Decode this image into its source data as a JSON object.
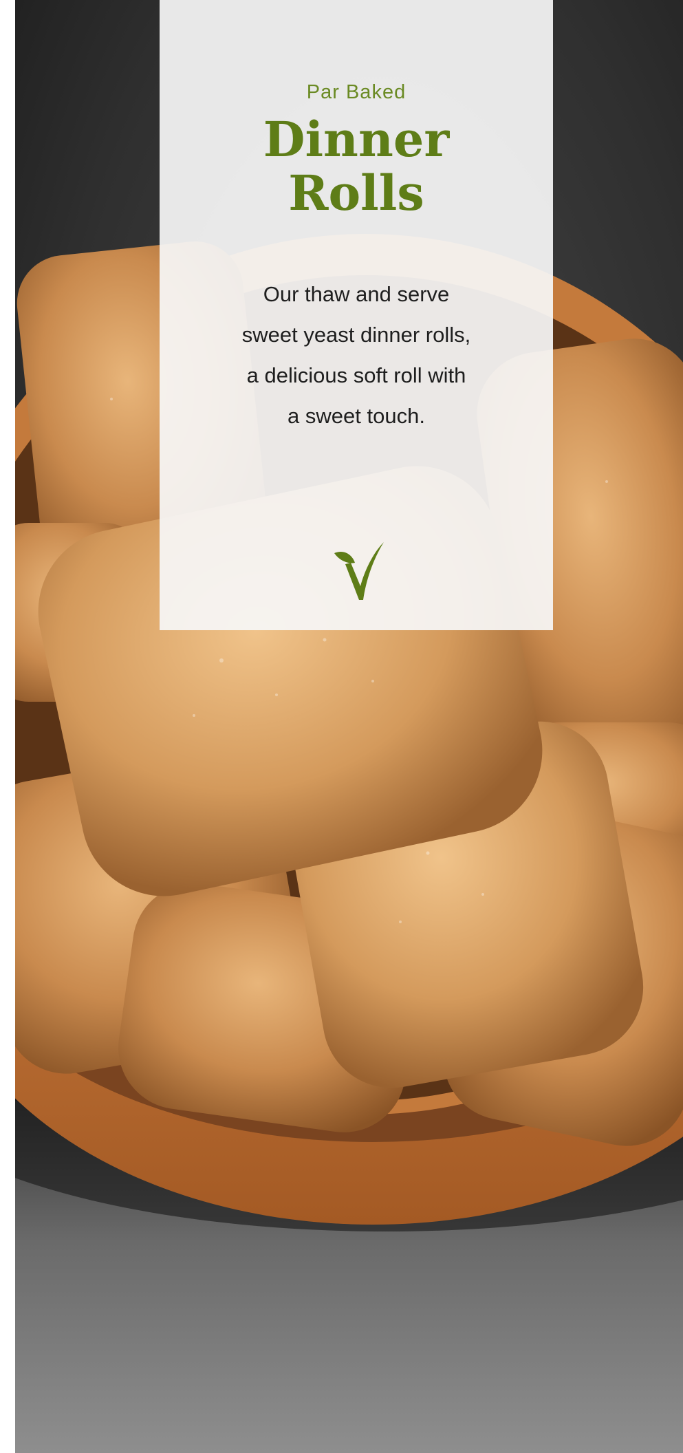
{
  "card": {
    "eyebrow": "Par Baked",
    "title_lines": [
      "Dinner",
      "Rolls"
    ],
    "description_lines": [
      "Our thaw and serve",
      "sweet yeast dinner rolls,",
      "a delicious soft roll with",
      "a sweet touch."
    ]
  },
  "icons": {
    "logo": "leaf-check-icon"
  },
  "colors": {
    "accent_green": "#5e7d17",
    "eyebrow_green": "#6a8a23",
    "body_text": "#1e1e1e",
    "card_background": "#f6f6f6"
  }
}
